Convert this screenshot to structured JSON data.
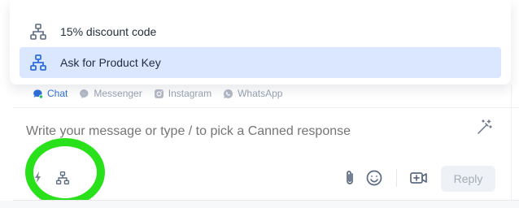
{
  "dropdown": {
    "items": [
      {
        "label": "15% discount code",
        "icon": "workflow-icon",
        "selected": false
      },
      {
        "label": "Ask for Product Key",
        "icon": "workflow-icon",
        "selected": true
      }
    ]
  },
  "channels": [
    {
      "label": "Chat",
      "icon": "chat-icon",
      "active": true
    },
    {
      "label": "Messenger",
      "icon": "messenger-icon",
      "active": false
    },
    {
      "label": "Instagram",
      "icon": "instagram-icon",
      "active": false
    },
    {
      "label": "WhatsApp",
      "icon": "whatsapp-icon",
      "active": false
    }
  ],
  "composer": {
    "placeholder": "Write your message or type / to pick a Canned response",
    "reply_label": "Reply"
  },
  "colors": {
    "accent": "#2f6fdb",
    "selected_bg": "#dbe7ff",
    "highlight": "#29e11a",
    "muted": "#98a2b3"
  },
  "icons": [
    "workflow-icon",
    "magic-wand-icon",
    "bolt-icon",
    "paperclip-icon",
    "emoji-icon",
    "video-icon"
  ]
}
